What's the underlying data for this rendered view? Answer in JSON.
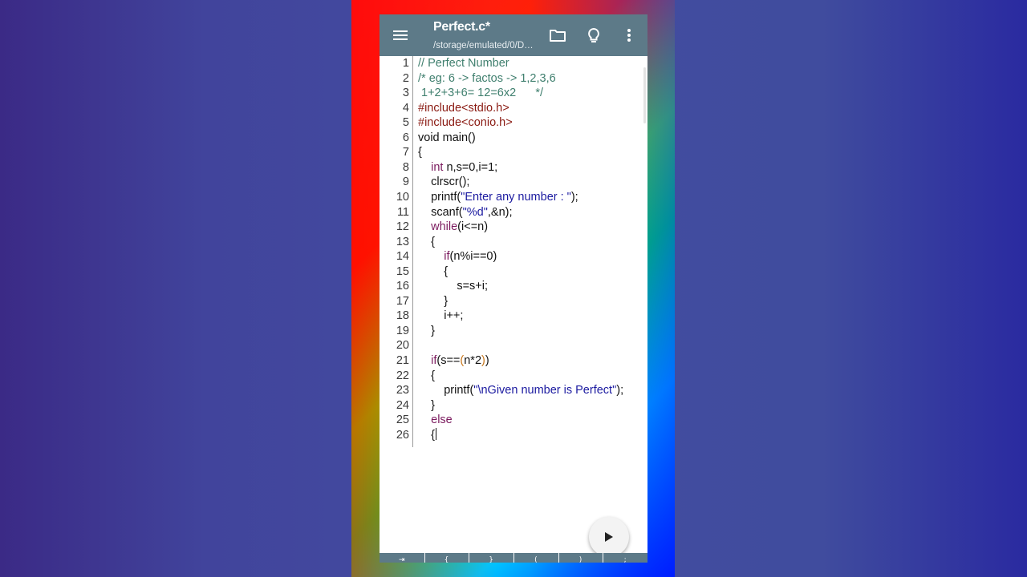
{
  "toolbar": {
    "title": "Perfect.c*",
    "subtitle": "/storage/emulated/0/D…",
    "menu_icon": "hamburger-menu-icon",
    "folder_icon": "folder-icon",
    "bulb_icon": "lightbulb-icon",
    "more_icon": "more-vert-icon"
  },
  "colors": {
    "toolbar": "#5d7a88",
    "comment": "#3f7f6e",
    "preprocessor": "#8a1a12",
    "keyword": "#7b1a5e",
    "string": "#1b1aa0"
  },
  "code": [
    {
      "n": "1",
      "t": [
        {
          "s": "// Perfect Number",
          "c": "comment"
        }
      ]
    },
    {
      "n": "2",
      "t": [
        {
          "s": "/* eg: 6 -> factos -> 1,2,3,6",
          "c": "comment"
        }
      ]
    },
    {
      "n": "3",
      "t": [
        {
          "s": " 1+2+3+6= 12=6x2      */",
          "c": "comment"
        }
      ]
    },
    {
      "n": "4",
      "t": [
        {
          "s": "#include<stdio.h>",
          "c": "pre"
        }
      ]
    },
    {
      "n": "5",
      "t": [
        {
          "s": "#include<conio.h>",
          "c": "pre"
        }
      ]
    },
    {
      "n": "6",
      "t": [
        {
          "s": "void main()",
          "c": ""
        }
      ]
    },
    {
      "n": "7",
      "t": [
        {
          "s": "{",
          "c": ""
        }
      ]
    },
    {
      "n": "8",
      "t": [
        {
          "s": "    ",
          "c": ""
        },
        {
          "s": "int",
          "c": "kw"
        },
        {
          "s": " n,s=0,i=1;",
          "c": ""
        }
      ]
    },
    {
      "n": "9",
      "t": [
        {
          "s": "    clrscr();",
          "c": ""
        }
      ]
    },
    {
      "n": "10",
      "t": [
        {
          "s": "    printf(",
          "c": ""
        },
        {
          "s": "\"Enter any number : \"",
          "c": "str"
        },
        {
          "s": ");",
          "c": ""
        }
      ]
    },
    {
      "n": "11",
      "t": [
        {
          "s": "    scanf(",
          "c": ""
        },
        {
          "s": "\"%d\"",
          "c": "str"
        },
        {
          "s": ",&n);",
          "c": ""
        }
      ]
    },
    {
      "n": "12",
      "t": [
        {
          "s": "    ",
          "c": ""
        },
        {
          "s": "while",
          "c": "kw"
        },
        {
          "s": "(i<=n)",
          "c": ""
        }
      ]
    },
    {
      "n": "13",
      "t": [
        {
          "s": "    {",
          "c": ""
        }
      ]
    },
    {
      "n": "14",
      "t": [
        {
          "s": "        ",
          "c": ""
        },
        {
          "s": "if",
          "c": "kw"
        },
        {
          "s": "(n%i==0)",
          "c": ""
        }
      ]
    },
    {
      "n": "15",
      "t": [
        {
          "s": "        {",
          "c": ""
        }
      ]
    },
    {
      "n": "16",
      "t": [
        {
          "s": "            s=s+i;",
          "c": ""
        }
      ]
    },
    {
      "n": "17",
      "t": [
        {
          "s": "        }",
          "c": ""
        }
      ]
    },
    {
      "n": "18",
      "t": [
        {
          "s": "        i++;",
          "c": ""
        }
      ]
    },
    {
      "n": "19",
      "t": [
        {
          "s": "    }",
          "c": ""
        }
      ]
    },
    {
      "n": "20",
      "t": []
    },
    {
      "n": "21",
      "t": [
        {
          "s": "    ",
          "c": ""
        },
        {
          "s": "if",
          "c": "kw"
        },
        {
          "s": "(s==",
          "c": ""
        },
        {
          "s": "(",
          "c": "paren"
        },
        {
          "s": "n*2",
          "c": ""
        },
        {
          "s": ")",
          "c": "paren"
        },
        {
          "s": ")",
          "c": ""
        }
      ]
    },
    {
      "n": "22",
      "t": [
        {
          "s": "    {",
          "c": ""
        }
      ]
    },
    {
      "n": "23",
      "t": [
        {
          "s": "        printf(",
          "c": ""
        },
        {
          "s": "\"\\nGiven number is Perfect\"",
          "c": "str"
        },
        {
          "s": ");",
          "c": ""
        }
      ]
    },
    {
      "n": "24",
      "t": [
        {
          "s": "    }",
          "c": ""
        }
      ]
    },
    {
      "n": "25",
      "t": [
        {
          "s": "    ",
          "c": ""
        },
        {
          "s": "else",
          "c": "kw"
        }
      ]
    },
    {
      "n": "26",
      "t": [
        {
          "s": "    {",
          "c": ""
        }
      ],
      "cursor": true
    }
  ],
  "fab": {
    "icon": "play-icon"
  },
  "symbol_bar": {
    "keys": [
      "⇥",
      "{",
      "}",
      "(",
      ")",
      ";"
    ]
  }
}
